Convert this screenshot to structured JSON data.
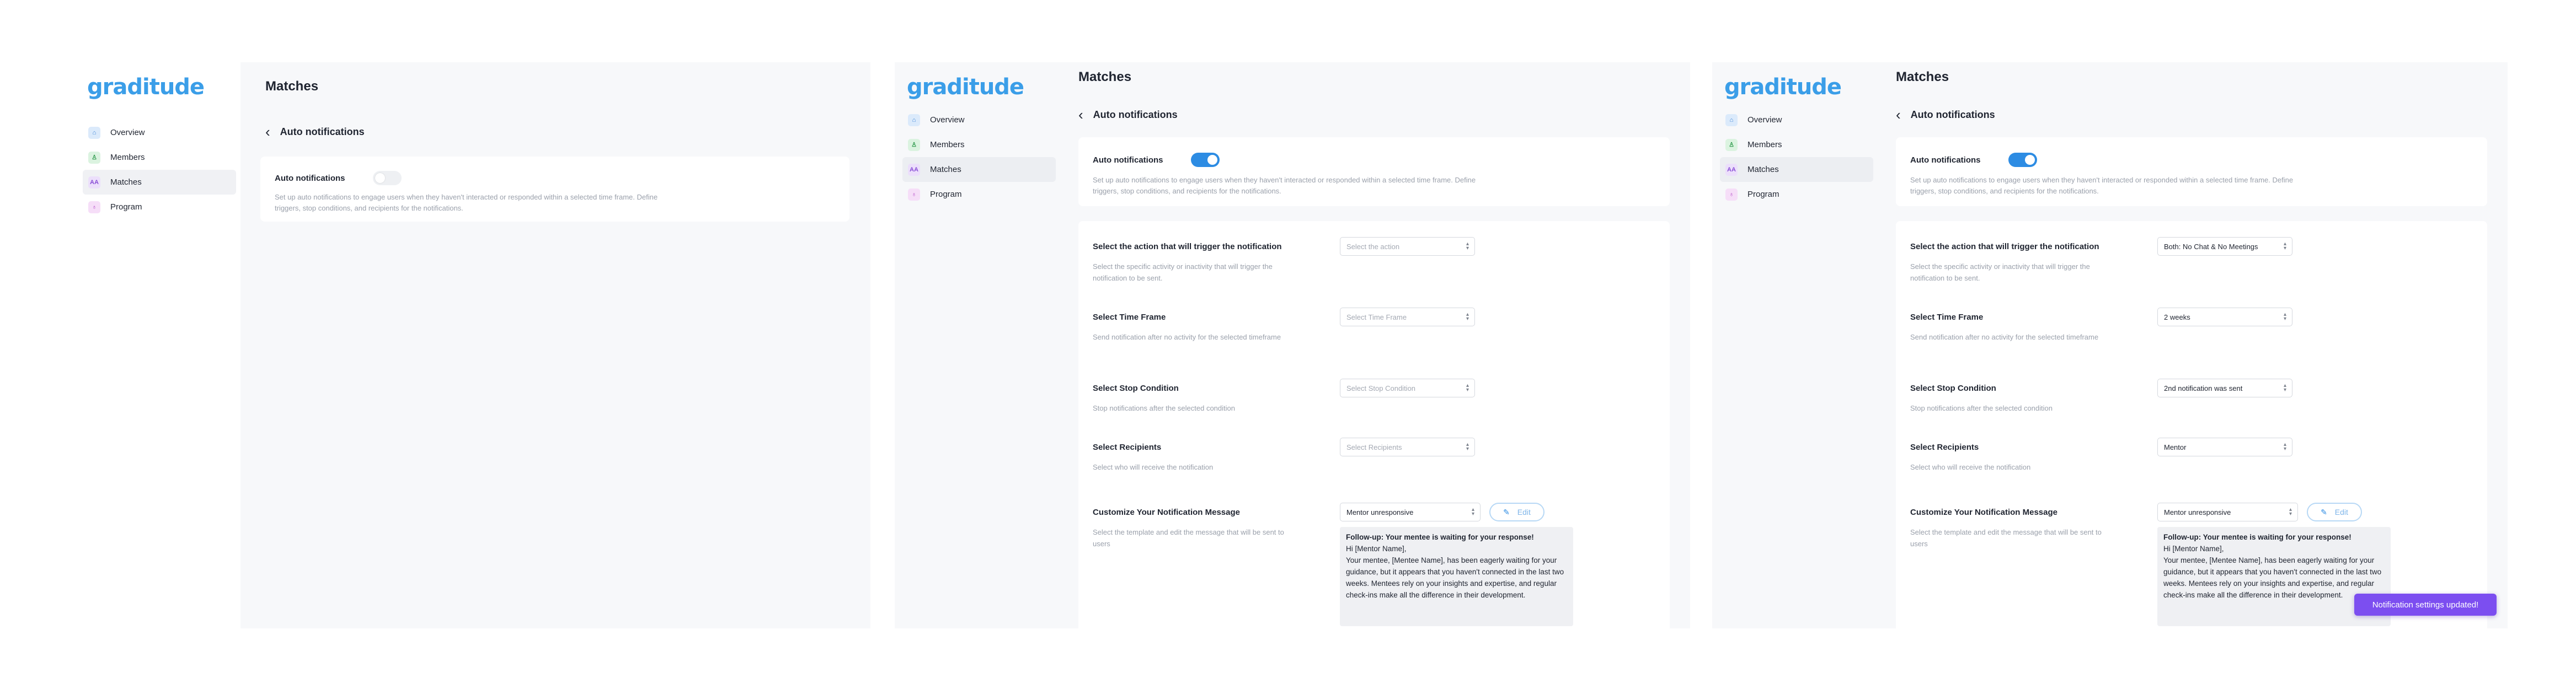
{
  "app": {
    "logo_text": "graditude",
    "brand_color": "#3b9ee8",
    "accent_color": "#2d8ce3",
    "toast_color": "#7c4ef0"
  },
  "sidebar": {
    "items": [
      {
        "label": "Overview",
        "icon": "home-icon",
        "icon_glyph": "⌂"
      },
      {
        "label": "Members",
        "icon": "person-icon",
        "icon_glyph": "♙"
      },
      {
        "label": "Matches",
        "icon": "pair-icon",
        "icon_glyph": "AA"
      },
      {
        "label": "Program",
        "icon": "badge-icon",
        "icon_glyph": "♁"
      }
    ],
    "active": "Matches"
  },
  "header": {
    "page_title": "Matches",
    "back_icon": "‹",
    "subheader_title": "Auto notifications"
  },
  "auto_notifications": {
    "label": "Auto notifications",
    "description": "Set up auto notifications to engage users when they haven't interacted or responded within a selected time frame. Define triggers, stop conditions, and recipients for the notifications.",
    "screen1_enabled": false,
    "screen2_enabled": true,
    "screen3_enabled": true
  },
  "settings": {
    "action": {
      "title": "Select the action that will trigger the notification",
      "description": "Select the specific activity or inactivity that will trigger the notification to be sent.",
      "placeholder": "Select the action",
      "value": "Both: No Chat & No Meetings"
    },
    "time_frame": {
      "title": "Select Time Frame",
      "description": "Send notification after no activity for the selected timeframe",
      "placeholder": "Select Time Frame",
      "value": "2 weeks"
    },
    "stop_condition": {
      "title": "Select Stop Condition",
      "description": "Stop notifications after the selected condition",
      "placeholder": "Select Stop Condition",
      "value": "2nd notification was sent"
    },
    "recipients": {
      "title": "Select Recipients",
      "description": "Select who will receive the notification",
      "placeholder": "Select Recipients",
      "value": "Mentor"
    },
    "message": {
      "title": "Customize Your Notification Message",
      "description": "Select the template and edit the message that will be sent to users",
      "template_value": "Mentor unresponsive",
      "edit_label": "Edit",
      "subject": "Follow-up: Your mentee is waiting for your response!",
      "greeting": "Hi [Mentor Name],",
      "body": "Your mentee, [Mentee Name], has been eagerly waiting for your guidance, but it appears that you haven't connected in the last two weeks. Mentees rely on your insights and expertise, and regular check-ins make all the difference in their development."
    }
  },
  "toast": {
    "text": "Notification settings updated!"
  }
}
